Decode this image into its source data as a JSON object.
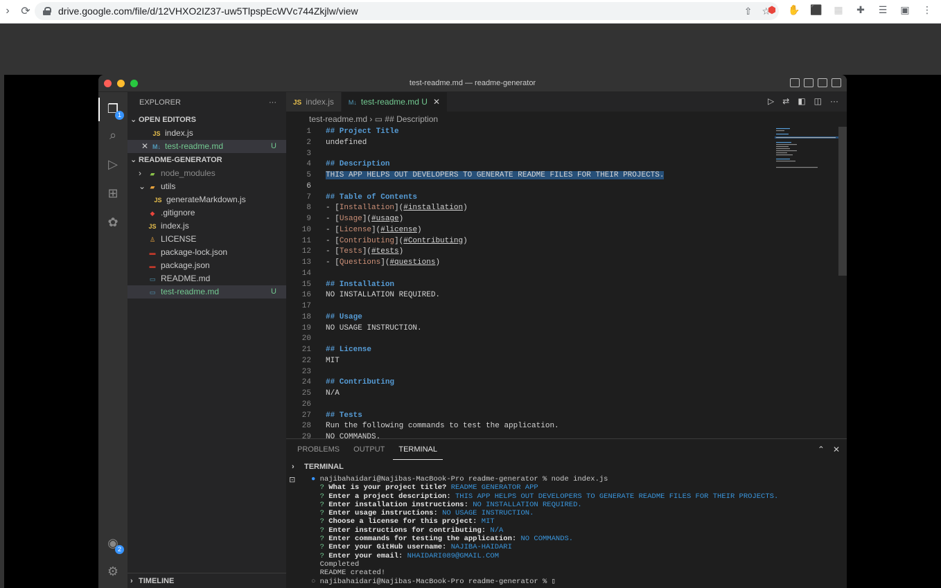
{
  "browser": {
    "url": "drive.google.com/file/d/12VHXO2IZ37-uw5TlpspEcWVc744Zkjlw/view"
  },
  "window": {
    "title": "test-readme.md — readme-generator"
  },
  "activity_badges": {
    "explorer": "1",
    "accounts": "2"
  },
  "sidebar": {
    "header": "EXPLORER",
    "open_editors_label": "OPEN EDITORS",
    "open_editors": [
      {
        "icon": "JS",
        "label": "index.js"
      },
      {
        "icon": "M↓",
        "label": "test-readme.md",
        "status": "U"
      }
    ],
    "project_label": "README-GENERATOR",
    "tree": [
      {
        "label": "node_modules",
        "indent": 1
      },
      {
        "label": "utils",
        "indent": 1
      },
      {
        "label": "generateMarkdown.js",
        "indent": 2
      },
      {
        "label": ".gitignore",
        "indent": 1
      },
      {
        "label": "index.js",
        "indent": 1
      },
      {
        "label": "LICENSE",
        "indent": 1
      },
      {
        "label": "package-lock.json",
        "indent": 1
      },
      {
        "label": "package.json",
        "indent": 1
      },
      {
        "label": "README.md",
        "indent": 1
      },
      {
        "label": "test-readme.md",
        "indent": 1,
        "status": "U"
      }
    ],
    "timeline_label": "TIMELINE"
  },
  "editor": {
    "tabs": [
      {
        "icon": "JS",
        "label": "index.js"
      },
      {
        "icon": "M↓",
        "label": "test-readme.md",
        "status": "U"
      }
    ],
    "breadcrumb": [
      "test-readme.md",
      "## Description"
    ],
    "lines": [
      "## Project Title",
      "undefined",
      "",
      "## Description",
      "THIS APP HELPS OUT DEVELOPERS TO GENERATE README FILES FOR THEIR PROJECTS.",
      "",
      "## Table of Contents",
      "- [Installation](#installation)",
      "- [Usage](#usage)",
      "- [License](#license)",
      "- [Contributing](#Contributing)",
      "- [Tests](#tests)",
      "- [Questions](#questions)",
      "",
      "## Installation",
      "NO INSTALLATION REQUIRED.",
      "",
      "## Usage",
      "NO USAGE INSTRUCTION.",
      "",
      "## License",
      "MIT",
      "",
      "## Contributing",
      "N/A",
      "",
      "## Tests",
      "Run the following commands to test the application.",
      "NO COMMANDS."
    ],
    "current_line": 6,
    "selected_line": 5
  },
  "panel": {
    "tabs": [
      "PROBLEMS",
      "OUTPUT",
      "TERMINAL"
    ],
    "active_tab": "TERMINAL",
    "section_label": "TERMINAL",
    "prompt_line": "najibahaidari@Najibas-MacBook-Pro readme-generator % node index.js",
    "qa": [
      {
        "q": "What is your project title?",
        "a": "README GENERATOR APP"
      },
      {
        "q": "Enter a project description:",
        "a": "THIS APP HELPS OUT DEVELOPERS TO GENERATE README FILES FOR THEIR PROJECTS."
      },
      {
        "q": "Enter installation instructions:",
        "a": "NO INSTALLATION REQUIRED."
      },
      {
        "q": "Enter usage instructions:",
        "a": "NO USAGE INSTRUCTION."
      },
      {
        "q": "Choose a license for this project:",
        "a": "MIT"
      },
      {
        "q": "Enter instructions for contributing:",
        "a": "N/A"
      },
      {
        "q": "Enter commands for testing the application:",
        "a": "NO COMMANDS."
      },
      {
        "q": "Enter your GitHub username:",
        "a": "NAJIBA-HAIDARI"
      },
      {
        "q": "Enter your email:",
        "a": "NHAIDARI089@GMAIL.COM"
      }
    ],
    "completed": "Completed",
    "created": "README created!",
    "final_prompt": "najibahaidari@Najibas-MacBook-Pro readme-generator % "
  }
}
